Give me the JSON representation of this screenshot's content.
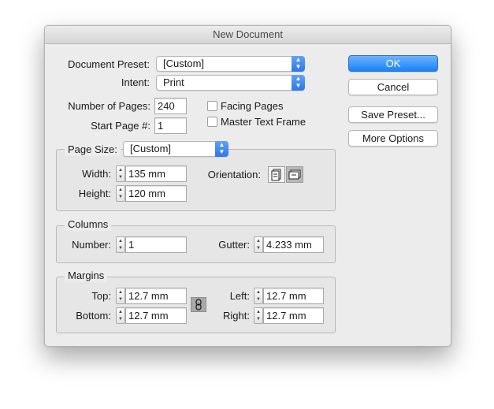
{
  "window": {
    "title": "New Document"
  },
  "document_preset": {
    "label": "Document Preset:",
    "value": "[Custom]"
  },
  "intent": {
    "label": "Intent:",
    "value": "Print"
  },
  "pages": {
    "number_label": "Number of Pages:",
    "number_value": "240",
    "start_label": "Start Page #:",
    "start_value": "1",
    "facing_label": "Facing Pages",
    "facing_checked": false,
    "master_label": "Master Text Frame",
    "master_checked": false
  },
  "page_size": {
    "label": "Page Size:",
    "value": "[Custom]",
    "width_label": "Width:",
    "width_value": "135 mm",
    "height_label": "Height:",
    "height_value": "120 mm",
    "orientation_label": "Orientation:",
    "orientation_selected": "landscape"
  },
  "columns": {
    "title": "Columns",
    "number_label": "Number:",
    "number_value": "1",
    "gutter_label": "Gutter:",
    "gutter_value": "4.233 mm"
  },
  "margins": {
    "title": "Margins",
    "top_label": "Top:",
    "top_value": "12.7 mm",
    "bottom_label": "Bottom:",
    "bottom_value": "12.7 mm",
    "left_label": "Left:",
    "left_value": "12.7 mm",
    "right_label": "Right:",
    "right_value": "12.7 mm"
  },
  "buttons": {
    "ok": "OK",
    "cancel": "Cancel",
    "save_preset": "Save Preset...",
    "more_options": "More Options"
  },
  "colors": {
    "accent": "#1a82fb",
    "dialog_bg": "#ececec"
  }
}
